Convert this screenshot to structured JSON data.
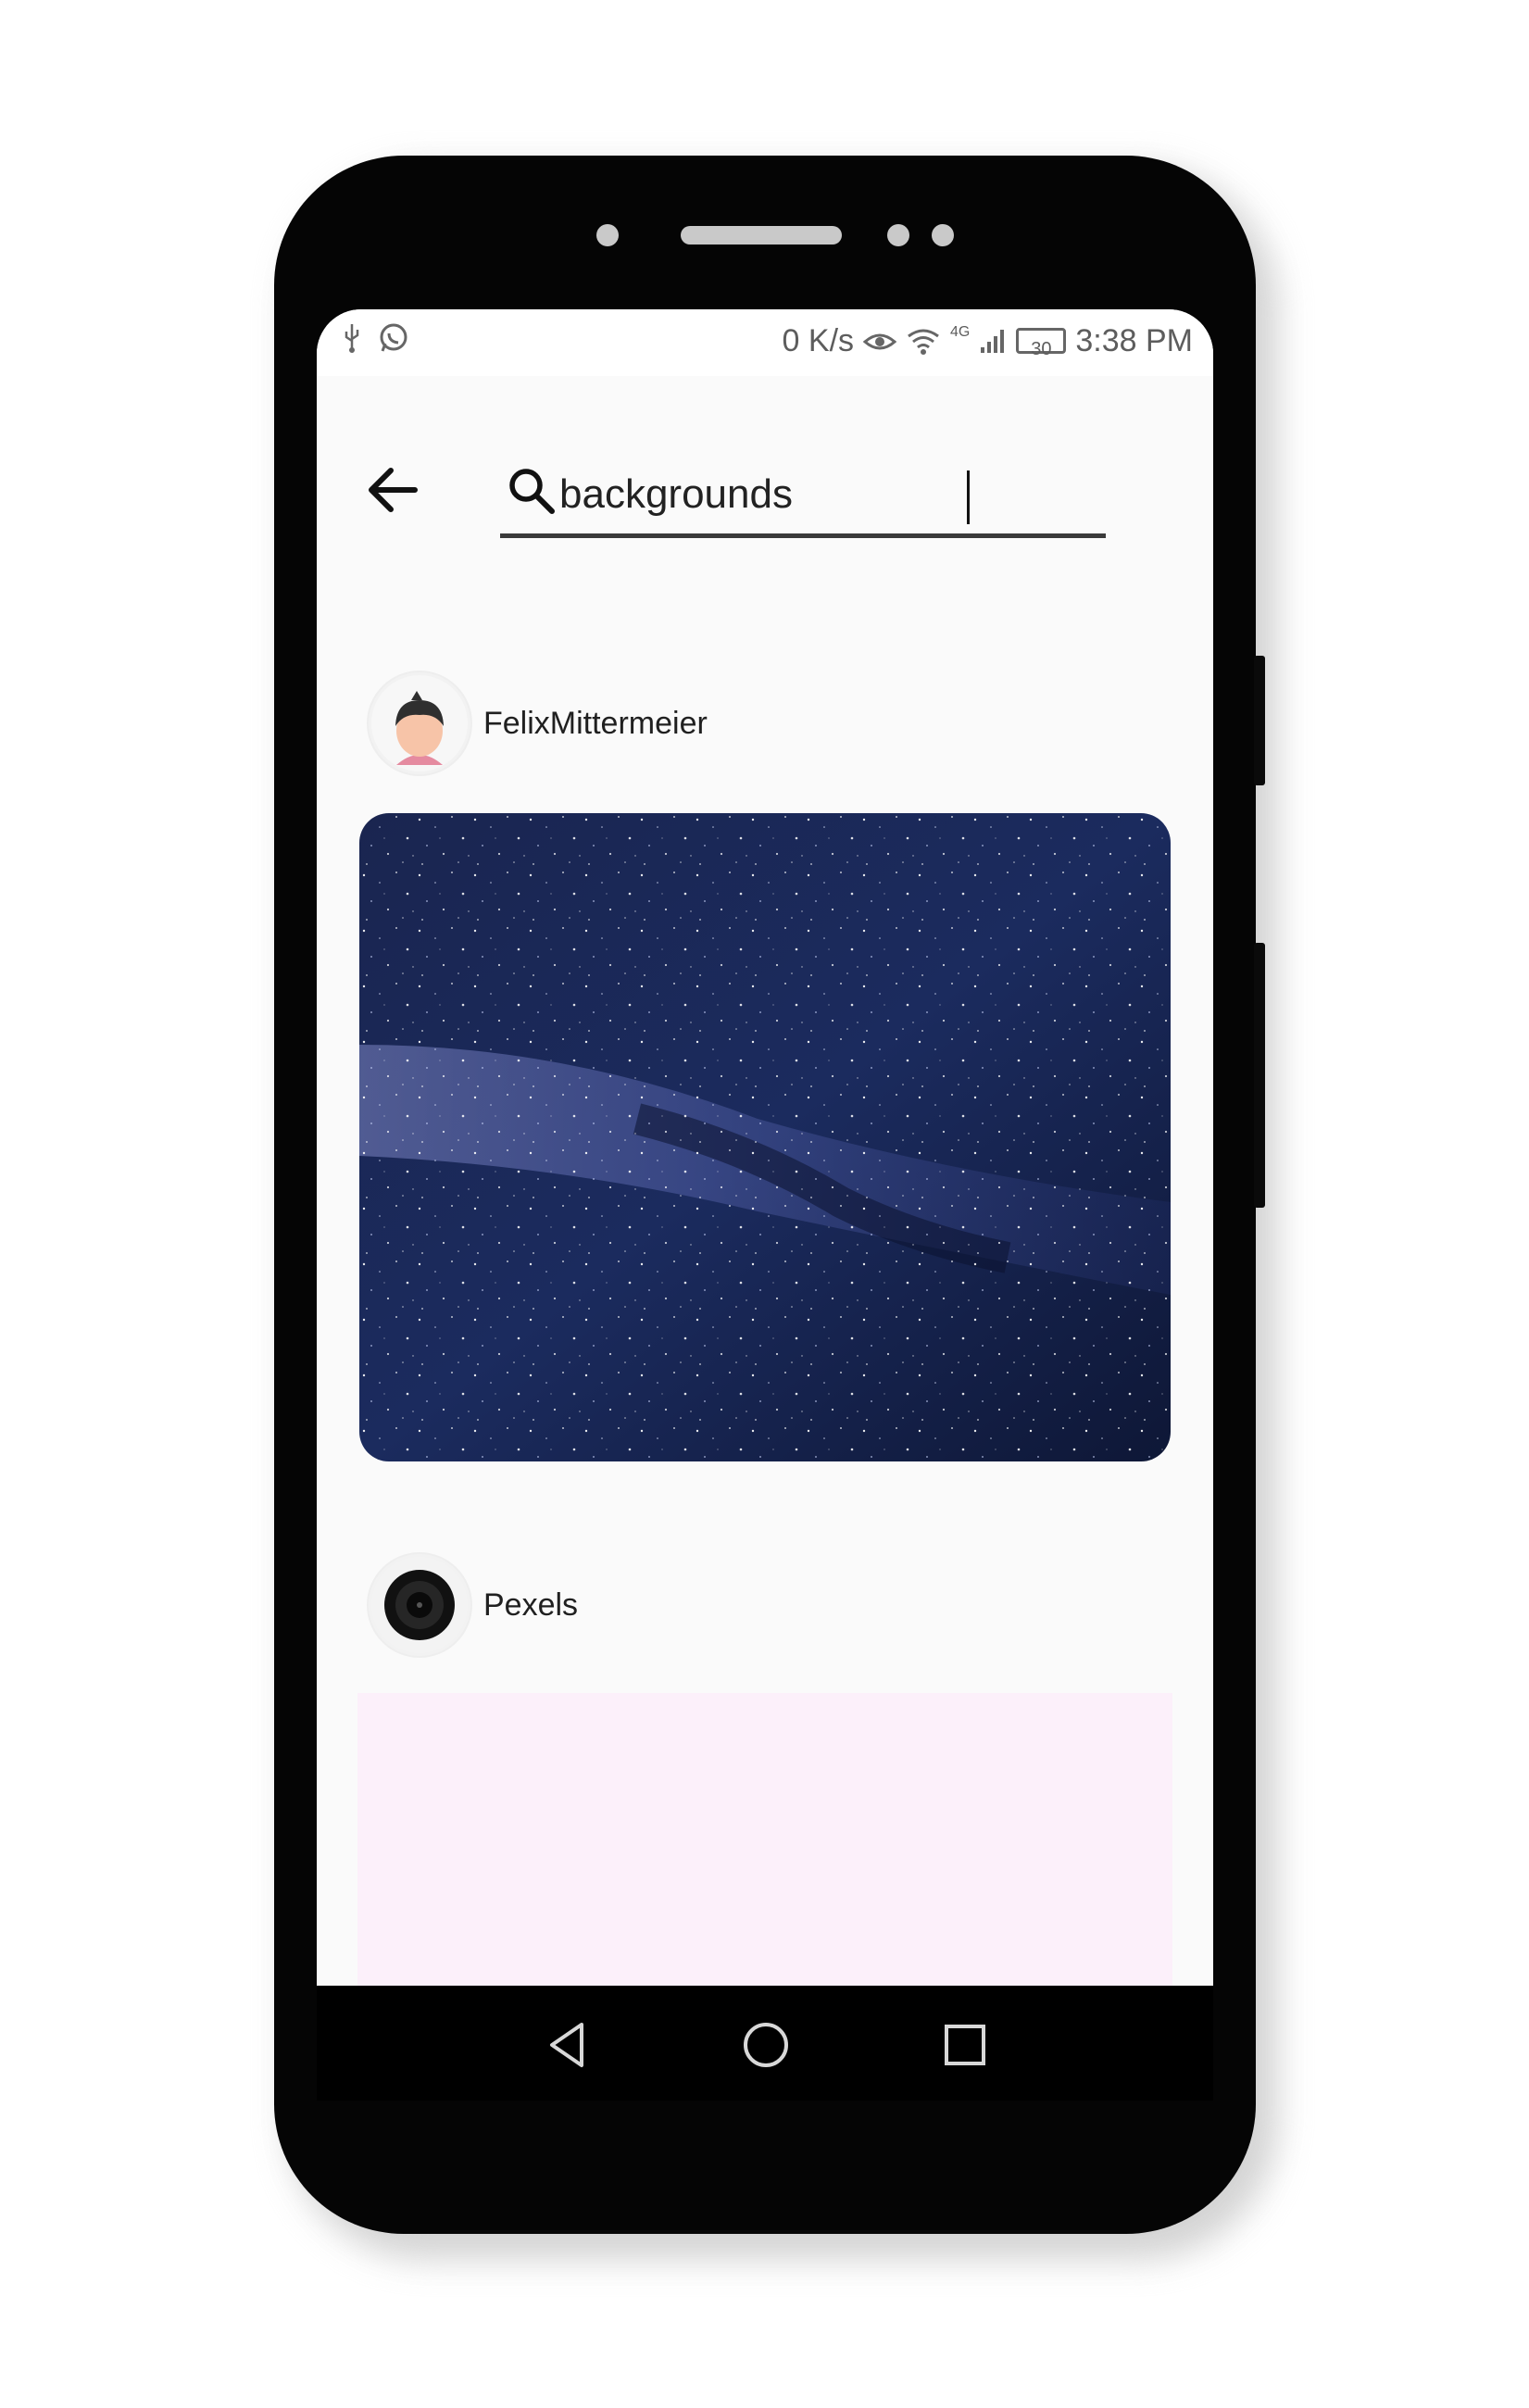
{
  "status_bar": {
    "left_icons": [
      "usb-icon",
      "whatsapp-icon"
    ],
    "speed": "0 K/s",
    "network": "4G",
    "battery": "30",
    "time": "3:38 PM"
  },
  "search": {
    "value": "backgrounds",
    "back_icon": "arrow-left-icon",
    "search_icon": "search-icon"
  },
  "posts": [
    {
      "username": "FelixMittermeier",
      "avatar_icon": "person-avatar-icon"
    },
    {
      "username": "Pexels",
      "avatar_icon": "camera-lens-avatar-icon"
    }
  ],
  "nav_bar": {
    "icons": [
      "back-triangle-icon",
      "home-circle-icon",
      "recents-square-icon"
    ]
  },
  "colors": {
    "screen_bg": "#fafafa",
    "placeholder_bg": "#fcf0fa",
    "phone_body": "#050505"
  }
}
